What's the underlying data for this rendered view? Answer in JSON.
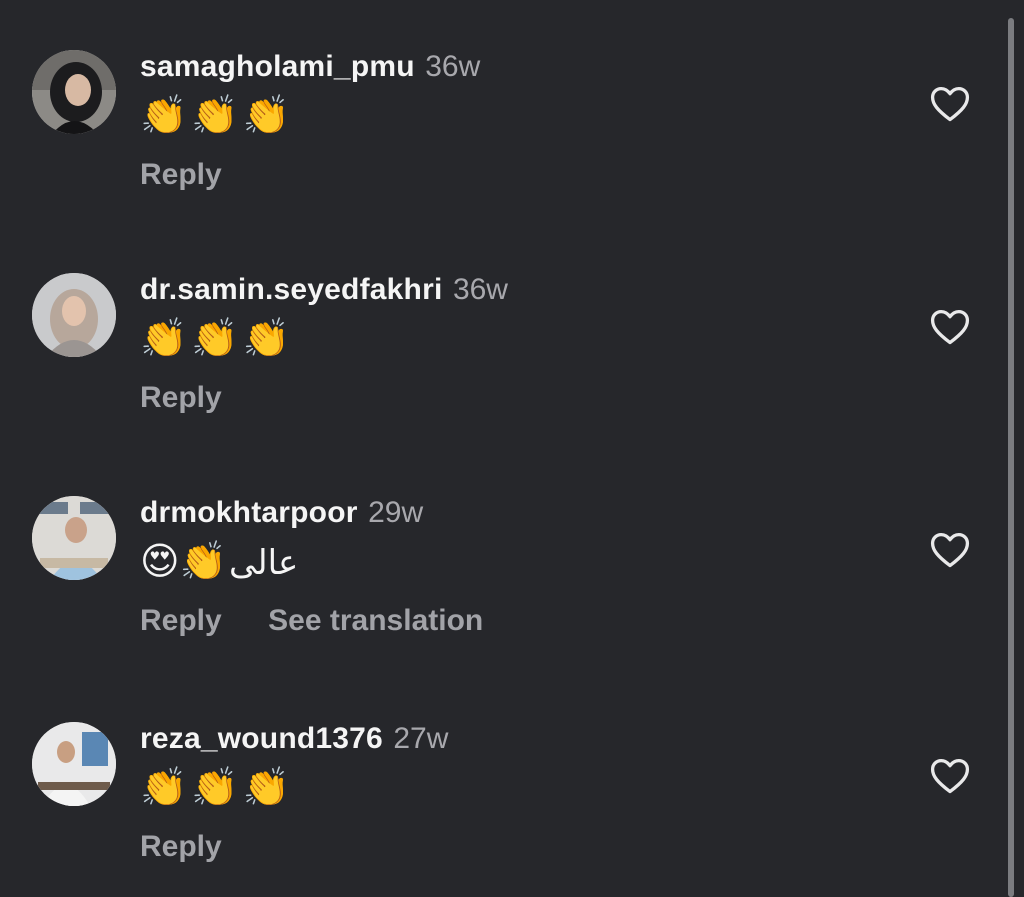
{
  "comments": [
    {
      "username": "samagholami_pmu",
      "time": "36w",
      "text": "👏👏👏",
      "farsi": "",
      "actions": [
        "Reply"
      ]
    },
    {
      "username": "dr.samin.seyedfakhri",
      "time": "36w",
      "text": "👏👏👏",
      "farsi": "",
      "actions": [
        "Reply"
      ]
    },
    {
      "username": "drmokhtarpoor",
      "time": "29w",
      "text": "😍👏",
      "farsi": "عالی",
      "actions": [
        "Reply",
        "See translation"
      ]
    },
    {
      "username": "reza_wound1376",
      "time": "27w",
      "text": "👏👏👏",
      "farsi": "",
      "actions": [
        "Reply"
      ]
    }
  ],
  "icons": {
    "like": "heart-outline-icon",
    "avatar": "user-avatar"
  },
  "colors": {
    "background": "#26272b",
    "username": "#f5f5f5",
    "muted": "#a2a3a8"
  }
}
